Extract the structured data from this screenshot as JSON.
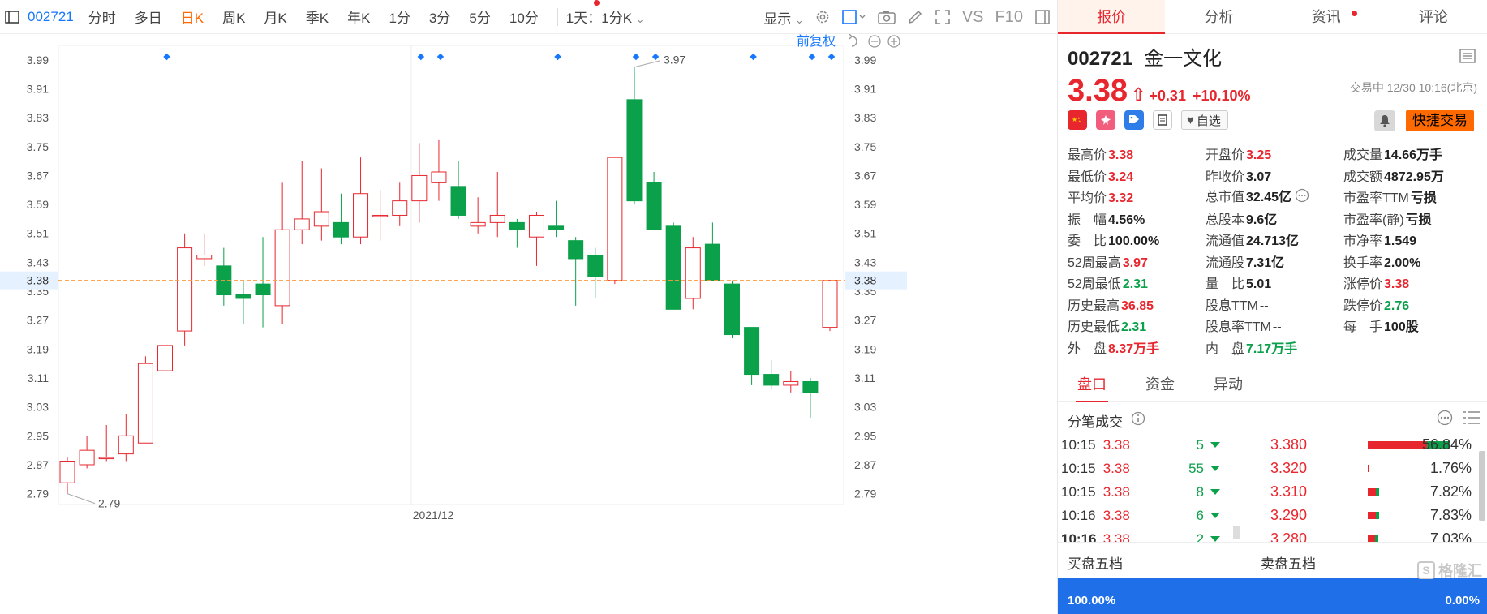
{
  "toolbar": {
    "stock_code": "002721",
    "periods": [
      "分时",
      "多日",
      "日K",
      "周K",
      "月K",
      "季K",
      "年K",
      "1分",
      "3分",
      "5分",
      "10分"
    ],
    "active_period": "日K",
    "interval_select": "1天：1分K",
    "display_label": "显示",
    "vs_label": "VS",
    "f10_label": "F10"
  },
  "chart_header": {
    "adjust_label": "前复权"
  },
  "chart_data": {
    "type": "candlestick",
    "y_ticks": [
      "3.99",
      "3.91",
      "3.83",
      "3.75",
      "3.67",
      "3.59",
      "3.51",
      "3.43",
      "3.35",
      "3.27",
      "3.19",
      "3.11",
      "3.03",
      "2.95",
      "2.87",
      "2.79"
    ],
    "ylim": [
      2.76,
      4.03
    ],
    "x_label": "2021/12",
    "current_price_label": "3.38",
    "current_price": 3.38,
    "max_annotation": "3.97",
    "min_annotation": "2.79",
    "candles": [
      {
        "o": 2.82,
        "h": 2.89,
        "l": 2.79,
        "c": 2.88
      },
      {
        "o": 2.87,
        "h": 2.95,
        "l": 2.86,
        "c": 2.91
      },
      {
        "o": 2.89,
        "h": 2.98,
        "l": 2.88,
        "c": 2.89
      },
      {
        "o": 2.9,
        "h": 3.01,
        "l": 2.88,
        "c": 2.95
      },
      {
        "o": 2.93,
        "h": 3.17,
        "l": 2.93,
        "c": 3.15
      },
      {
        "o": 3.13,
        "h": 3.23,
        "l": 3.13,
        "c": 3.2
      },
      {
        "o": 3.24,
        "h": 3.51,
        "l": 3.2,
        "c": 3.47
      },
      {
        "o": 3.44,
        "h": 3.51,
        "l": 3.42,
        "c": 3.45
      },
      {
        "o": 3.42,
        "h": 3.47,
        "l": 3.31,
        "c": 3.34
      },
      {
        "o": 3.34,
        "h": 3.38,
        "l": 3.26,
        "c": 3.33
      },
      {
        "o": 3.37,
        "h": 3.5,
        "l": 3.25,
        "c": 3.34
      },
      {
        "o": 3.31,
        "h": 3.65,
        "l": 3.26,
        "c": 3.52
      },
      {
        "o": 3.52,
        "h": 3.71,
        "l": 3.48,
        "c": 3.55
      },
      {
        "o": 3.53,
        "h": 3.69,
        "l": 3.49,
        "c": 3.57
      },
      {
        "o": 3.54,
        "h": 3.62,
        "l": 3.48,
        "c": 3.5
      },
      {
        "o": 3.5,
        "h": 3.72,
        "l": 3.48,
        "c": 3.62
      },
      {
        "o": 3.56,
        "h": 3.63,
        "l": 3.49,
        "c": 3.56
      },
      {
        "o": 3.56,
        "h": 3.65,
        "l": 3.53,
        "c": 3.6
      },
      {
        "o": 3.6,
        "h": 3.76,
        "l": 3.54,
        "c": 3.67
      },
      {
        "o": 3.65,
        "h": 3.77,
        "l": 3.6,
        "c": 3.68
      },
      {
        "o": 3.64,
        "h": 3.71,
        "l": 3.55,
        "c": 3.56
      },
      {
        "o": 3.53,
        "h": 3.61,
        "l": 3.51,
        "c": 3.54
      },
      {
        "o": 3.54,
        "h": 3.68,
        "l": 3.5,
        "c": 3.56
      },
      {
        "o": 3.54,
        "h": 3.55,
        "l": 3.47,
        "c": 3.52
      },
      {
        "o": 3.5,
        "h": 3.57,
        "l": 3.42,
        "c": 3.56
      },
      {
        "o": 3.53,
        "h": 3.6,
        "l": 3.5,
        "c": 3.52
      },
      {
        "o": 3.49,
        "h": 3.5,
        "l": 3.31,
        "c": 3.44
      },
      {
        "o": 3.45,
        "h": 3.47,
        "l": 3.33,
        "c": 3.39
      },
      {
        "o": 3.38,
        "h": 3.72,
        "l": 3.37,
        "c": 3.72
      },
      {
        "o": 3.88,
        "h": 3.97,
        "l": 3.59,
        "c": 3.6
      },
      {
        "o": 3.65,
        "h": 3.68,
        "l": 3.52,
        "c": 3.52
      },
      {
        "o": 3.53,
        "h": 3.54,
        "l": 3.3,
        "c": 3.3
      },
      {
        "o": 3.33,
        "h": 3.5,
        "l": 3.3,
        "c": 3.47
      },
      {
        "o": 3.48,
        "h": 3.54,
        "l": 3.38,
        "c": 3.38
      },
      {
        "o": 3.37,
        "h": 3.38,
        "l": 3.22,
        "c": 3.23
      },
      {
        "o": 3.25,
        "h": 3.25,
        "l": 3.09,
        "c": 3.12
      },
      {
        "o": 3.12,
        "h": 3.16,
        "l": 3.08,
        "c": 3.09
      },
      {
        "o": 3.09,
        "h": 3.13,
        "l": 3.07,
        "c": 3.1
      },
      {
        "o": 3.1,
        "h": 3.11,
        "l": 3.0,
        "c": 3.07
      },
      {
        "o": 3.25,
        "h": 3.38,
        "l": 3.24,
        "c": 3.38
      }
    ]
  },
  "panel": {
    "tabs": [
      "报价",
      "分析",
      "资讯",
      "评论"
    ],
    "active_tab": "报价",
    "code": "002721",
    "name": "金一文化",
    "price": "3.38",
    "change": "+0.31",
    "change_pct": "+10.10%",
    "status": "交易中 12/30 10:16(北京)",
    "fav_label": "自选",
    "quick_trade_label": "快捷交易",
    "quote": [
      [
        [
          "最高价",
          "3.38",
          "red"
        ],
        [
          "开盘价",
          "3.25",
          "red"
        ],
        [
          "成交量",
          "14.66万手",
          "dark"
        ]
      ],
      [
        [
          "最低价",
          "3.24",
          "red"
        ],
        [
          "昨收价",
          "3.07",
          "dark"
        ],
        [
          "成交额",
          "4872.95万",
          "dark"
        ]
      ],
      [
        [
          "平均价",
          "3.32",
          "red"
        ],
        [
          "总市值",
          "32.45亿",
          "dark"
        ],
        [
          "市盈率TTM",
          "亏损",
          "dark"
        ]
      ],
      [
        [
          "振　幅",
          "4.56%",
          "dark"
        ],
        [
          "总股本",
          "9.6亿",
          "dark"
        ],
        [
          "市盈率(静)",
          "亏损",
          "dark"
        ]
      ],
      [
        [
          "委　比",
          "100.00%",
          "dark"
        ],
        [
          "流通值",
          "24.713亿",
          "dark"
        ],
        [
          "市净率",
          "1.549",
          "dark"
        ]
      ],
      [
        [
          "52周最高",
          "3.97",
          "red"
        ],
        [
          "流通股",
          "7.31亿",
          "dark"
        ],
        [
          "换手率",
          "2.00%",
          "dark"
        ]
      ],
      [
        [
          "52周最低",
          "2.31",
          "green"
        ],
        [
          "量　比",
          "5.01",
          "dark"
        ],
        [
          "涨停价",
          "3.38",
          "red"
        ]
      ],
      [
        [
          "历史最高",
          "36.85",
          "red"
        ],
        [
          "股息TTM",
          "--",
          "dark"
        ],
        [
          "跌停价",
          "2.76",
          "green"
        ]
      ],
      [
        [
          "历史最低",
          "2.31",
          "green"
        ],
        [
          "股息率TTM",
          "--",
          "dark"
        ],
        [
          "每　手",
          "100股",
          "dark"
        ]
      ],
      [
        [
          "外　盘",
          "8.37万手",
          "red"
        ],
        [
          "内　盘",
          "7.17万手",
          "green"
        ],
        [
          "",
          "",
          ""
        ]
      ]
    ],
    "sub_tabs": [
      "盘口",
      "资金",
      "异动"
    ],
    "active_sub_tab": "盘口",
    "trades_title": "分笔成交",
    "trades": [
      {
        "time": "10:15",
        "price": "3.38",
        "vol": "5"
      },
      {
        "time": "10:15",
        "price": "3.38",
        "vol": "55"
      },
      {
        "time": "10:15",
        "price": "3.38",
        "vol": "8"
      },
      {
        "time": "10:16",
        "price": "3.38",
        "vol": "6"
      },
      {
        "time": "10:16",
        "price": "3.38",
        "vol": "2"
      }
    ],
    "distribution": [
      {
        "price": "3.380",
        "pct": "56.84%",
        "share": 0.5684
      },
      {
        "price": "3.320",
        "pct": "1.76%",
        "share": 0.0176
      },
      {
        "price": "3.310",
        "pct": "7.82%",
        "share": 0.0782
      },
      {
        "price": "3.290",
        "pct": "7.83%",
        "share": 0.0783
      },
      {
        "price": "3.280",
        "pct": "7.03%",
        "share": 0.0703
      }
    ],
    "buy5_label": "买盘五档",
    "sell5_label": "卖盘五档",
    "buy_pct": "100.00%",
    "sell_pct": "0.00%",
    "buy_share": 1.0,
    "watermark": "格隆汇"
  },
  "colors": {
    "up": "#e7262e",
    "down": "#0ba04a",
    "accent": "#ff6a00",
    "link": "#1677ff"
  }
}
